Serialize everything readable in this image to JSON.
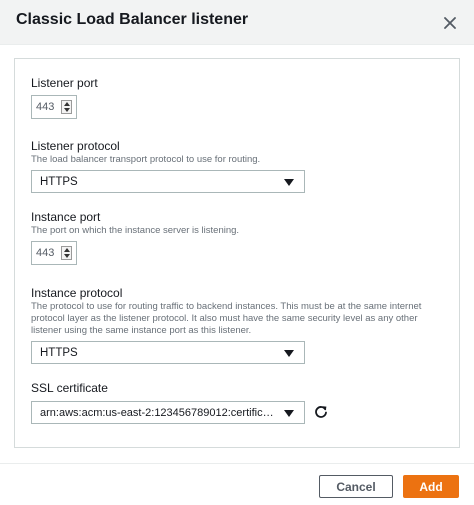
{
  "dialog": {
    "title": "Classic Load Balancer listener"
  },
  "form": {
    "listener_port": {
      "label": "Listener port",
      "value": "443"
    },
    "listener_protocol": {
      "label": "Listener protocol",
      "description": "The load balancer transport protocol to use for routing.",
      "value": "HTTPS"
    },
    "instance_port": {
      "label": "Instance port",
      "description": "The port on which the instance server is listening.",
      "value": "443"
    },
    "instance_protocol": {
      "label": "Instance protocol",
      "description_lines": [
        "The protocol to use for routing traffic to backend instances. This must be at the same internet",
        "protocol layer as the listener protocol. It also must have the same security level as any other",
        "listener using the same instance port as this listener."
      ],
      "value": "HTTPS"
    },
    "ssl_certificate": {
      "label": "SSL certificate",
      "value": "arn:aws:acm:us-east-2:123456789012:certific…"
    }
  },
  "footer": {
    "cancel_label": "Cancel",
    "add_label": "Add"
  },
  "colors": {
    "primary": "#ec7211",
    "header_bg": "#f2f3f3",
    "border": "#aab7b8"
  },
  "icons": {
    "close": "close-icon",
    "refresh": "refresh-icon",
    "caret": "caret-down-icon",
    "stepper": "stepper-arrows-icon"
  }
}
